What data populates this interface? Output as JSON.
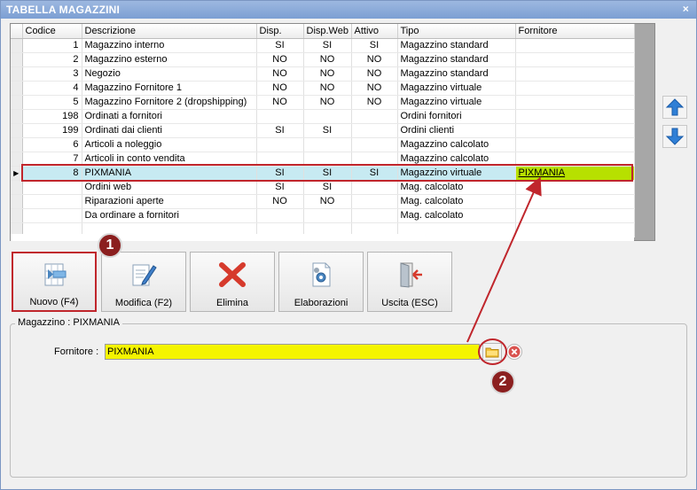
{
  "window": {
    "title": "TABELLA MAGAZZINI",
    "close_glyph": "×"
  },
  "table": {
    "columns": [
      "Codice",
      "Descrizione",
      "Disp.",
      "Disp.Web",
      "Attivo",
      "Tipo",
      "Fornitore"
    ],
    "rows": [
      {
        "codice": "1",
        "descrizione": "Magazzino interno",
        "disp": "SI",
        "disp_web": "SI",
        "attivo": "SI",
        "tipo": "Magazzino standard",
        "fornitore": ""
      },
      {
        "codice": "2",
        "descrizione": "Magazzino esterno",
        "disp": "NO",
        "disp_web": "NO",
        "attivo": "NO",
        "tipo": "Magazzino standard",
        "fornitore": ""
      },
      {
        "codice": "3",
        "descrizione": "Negozio",
        "disp": "NO",
        "disp_web": "NO",
        "attivo": "NO",
        "tipo": "Magazzino standard",
        "fornitore": ""
      },
      {
        "codice": "4",
        "descrizione": "Magazzino Fornitore 1",
        "disp": "NO",
        "disp_web": "NO",
        "attivo": "NO",
        "tipo": "Magazzino virtuale",
        "fornitore": ""
      },
      {
        "codice": "5",
        "descrizione": "Magazzino Fornitore 2 (dropshipping)",
        "disp": "NO",
        "disp_web": "NO",
        "attivo": "NO",
        "tipo": "Magazzino virtuale",
        "fornitore": ""
      },
      {
        "codice": "198",
        "descrizione": "Ordinati a fornitori",
        "disp": "",
        "disp_web": "",
        "attivo": "",
        "tipo": "Ordini fornitori",
        "fornitore": ""
      },
      {
        "codice": "199",
        "descrizione": "Ordinati dai clienti",
        "disp": "SI",
        "disp_web": "SI",
        "attivo": "",
        "tipo": "Ordini clienti",
        "fornitore": ""
      },
      {
        "codice": "6",
        "descrizione": "Articoli a noleggio",
        "disp": "",
        "disp_web": "",
        "attivo": "",
        "tipo": "Magazzino calcolato",
        "fornitore": ""
      },
      {
        "codice": "7",
        "descrizione": "Articoli in conto vendita",
        "disp": "",
        "disp_web": "",
        "attivo": "",
        "tipo": "Magazzino calcolato",
        "fornitore": ""
      },
      {
        "codice": "8",
        "descrizione": "PIXMANIA",
        "disp": "SI",
        "disp_web": "SI",
        "attivo": "SI",
        "tipo": "Magazzino virtuale",
        "fornitore": "PIXMANIA",
        "selected": true
      },
      {
        "codice": "",
        "descrizione": "Ordini web",
        "disp": "SI",
        "disp_web": "SI",
        "attivo": "",
        "tipo": "Mag. calcolato",
        "fornitore": ""
      },
      {
        "codice": "",
        "descrizione": "Riparazioni aperte",
        "disp": "NO",
        "disp_web": "NO",
        "attivo": "",
        "tipo": "Mag. calcolato",
        "fornitore": ""
      },
      {
        "codice": "",
        "descrizione": "Da ordinare a fornitori",
        "disp": "",
        "disp_web": "",
        "attivo": "",
        "tipo": "Mag. calcolato",
        "fornitore": ""
      }
    ],
    "row_indicator": "▶"
  },
  "toolbar": {
    "nuovo": "Nuovo (F4)",
    "modifica": "Modifica (F2)",
    "elimina": "Elimina",
    "elaborazioni": "Elaborazioni",
    "uscita": "Uscita (ESC)"
  },
  "detail": {
    "group_title": "Magazzino : PIXMANIA",
    "fornitore_label": "Fornitore :",
    "fornitore_value": "PIXMANIA"
  },
  "annotations": {
    "step1": "1",
    "step2": "2"
  },
  "colors": {
    "selection_row": "#c7eaf2",
    "highlight": "#b7e000",
    "input_bg": "#f4f400",
    "annotation": "#c0262c",
    "badge": "#8b1f1f"
  }
}
